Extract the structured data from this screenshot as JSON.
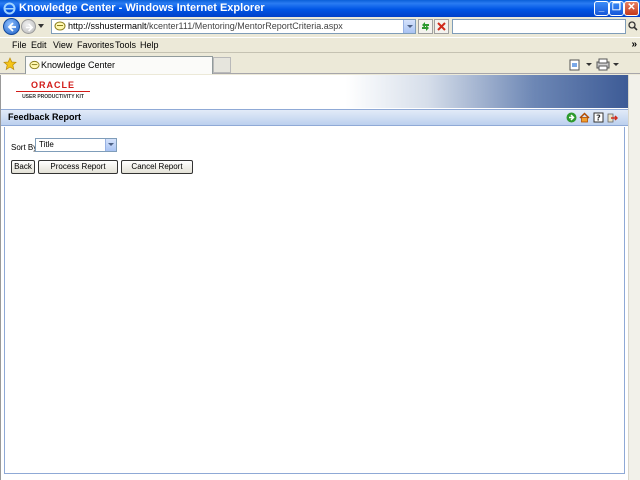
{
  "window": {
    "title": "Knowledge Center - Windows Internet Explorer"
  },
  "address_bar": {
    "url_host": "http://sshustermanlt",
    "url_path": "/kcenter111/Mentoring/MentorReportCriteria.aspx"
  },
  "menu": {
    "items": [
      "File",
      "Edit",
      "View",
      "Favorites",
      "Tools",
      "Help"
    ],
    "chevron": "»"
  },
  "tabs": [
    {
      "label": "Knowledge Center"
    }
  ],
  "banner": {
    "logo_top": "ORACLE",
    "logo_bottom": "USER PRODUCTIVITY KIT"
  },
  "page": {
    "title": "Feedback Report",
    "sort_label": "Sort By",
    "sort_value": "Title",
    "buttons": {
      "back": "Back",
      "process": "Process Report",
      "cancel": "Cancel Report"
    }
  },
  "colors": {
    "titlebar": "#0055e5",
    "header_bar": "#bcd0ee",
    "oracle_red": "#d21b18"
  },
  "icons": {
    "header": [
      "go-icon",
      "home-icon",
      "help-icon",
      "exit-icon"
    ]
  }
}
